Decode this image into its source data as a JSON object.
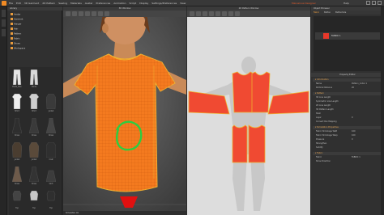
{
  "menubar": {
    "menus": [
      "File",
      "Edit",
      "3D Garment",
      "2D Pattern",
      "Sewing",
      "Materials",
      "Avatar",
      "Preferences",
      "Animation",
      "Script",
      "Display",
      "Settings/Preferences",
      "View"
    ],
    "title": "Marvelous Designer",
    "help": "Help"
  },
  "library": {
    "header": "Library",
    "tree": [
      "Avatar",
      "Garment",
      "Hanger",
      "Hair",
      "Pattern",
      "Fabric",
      "Shoes",
      "Workspace"
    ],
    "items": [
      {
        "label": "Pants_Men",
        "kind": "pants",
        "color": "#e6e6e6"
      },
      {
        "label": "Pants",
        "kind": "pants",
        "color": "#d8d8d8"
      },
      {
        "label": "",
        "kind": "empty",
        "color": ""
      },
      {
        "label": "Tshirt",
        "kind": "shirt",
        "color": "#eeeeee"
      },
      {
        "label": "Tshirt",
        "kind": "shirt",
        "color": "#cfcfcf"
      },
      {
        "label": "Jacket",
        "kind": "jacket",
        "color": "#3a3a3a"
      },
      {
        "label": "Dress",
        "kind": "dress",
        "color": "#2e2e2e"
      },
      {
        "label": "Dress",
        "kind": "dress",
        "color": "#3a3a3a"
      },
      {
        "label": "Dress",
        "kind": "dress",
        "color": "#454545"
      },
      {
        "label": "Jacket",
        "kind": "jacket",
        "color": "#4a3d30"
      },
      {
        "label": "Jacket",
        "kind": "jacket",
        "color": "#5a4a3a"
      },
      {
        "label": "Coat",
        "kind": "coat",
        "color": "#2f2f2f"
      },
      {
        "label": "Dress",
        "kind": "dress",
        "color": "#6d5a4a"
      },
      {
        "label": "Dress",
        "kind": "dress",
        "color": "#333333"
      },
      {
        "label": "Skirt",
        "kind": "skirt",
        "color": "#3c3c3c"
      },
      {
        "label": "Top",
        "kind": "top",
        "color": "#444444"
      },
      {
        "label": "Top",
        "kind": "top",
        "color": "#c8c8c8"
      },
      {
        "label": "Top",
        "kind": "top",
        "color": "#2f2f2f"
      }
    ]
  },
  "viewport3d": {
    "title": "3D Window",
    "status": "Simulation On",
    "colors": {
      "garment": "#f47a1f",
      "skin": "#c98a58",
      "hair": "#6b3c1c",
      "annotation": "#2ecc40",
      "briefs": "#e01010"
    }
  },
  "viewport2d": {
    "title": "2D Pattern Window",
    "colors": {
      "pattern": "#f04a32",
      "stitch": "#f0b030",
      "background": "#dddddd"
    }
  },
  "object_browser": {
    "header": "Object Browser",
    "tabs": [
      "Fabric",
      "Button",
      "Buttonhole"
    ],
    "fabric_name": "FABRIC 1",
    "fabric_color": "#e8382a"
  },
  "property_editor": {
    "header": "Property Editor",
    "sections": [
      {
        "title": "Information",
        "rows": [
          {
            "label": "Name",
            "value": "Pattern_Collar 1"
          },
          {
            "label": "Particle Distance",
            "value": "20"
          }
        ]
      },
      {
        "label_only": true,
        "title": "Pattern",
        "rows": [
          {
            "label": "3D Line Length",
            "value": ""
          },
          {
            "label": "Symmetric Line Length",
            "value": ""
          },
          {
            "label": "2D Line Length",
            "value": ""
          },
          {
            "label": "3D Pattern Length",
            "value": ""
          },
          {
            "label": "Shell",
            "value": ""
          },
          {
            "label": "Layer",
            "value": "0"
          },
          {
            "label": "Convert Pen Mapping",
            "value": ""
          }
        ]
      },
      {
        "title": "Simulation Properties",
        "rows": [
          {
            "label": "Fabric Shrinkage Weft",
            "value": "100"
          },
          {
            "label": "Fabric Shrinkage Warp",
            "value": "100"
          },
          {
            "label": "Pressure",
            "value": "0"
          },
          {
            "label": "Strengthen",
            "value": ""
          },
          {
            "label": "Solidify",
            "value": ""
          }
        ]
      },
      {
        "title": "Fabric",
        "rows": [
          {
            "label": "Fabric",
            "value": "FABRIC 1"
          },
          {
            "label": "Show Direction",
            "value": ""
          }
        ]
      }
    ]
  }
}
